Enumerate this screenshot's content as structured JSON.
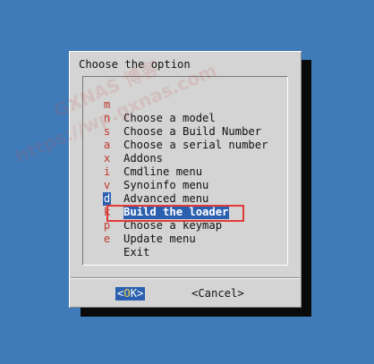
{
  "dialog": {
    "title": "Choose the option"
  },
  "menu": {
    "items": [
      {
        "key": "m",
        "label": "Choose a model"
      },
      {
        "key": "n",
        "label": "Choose a Build Number"
      },
      {
        "key": "s",
        "label": "Choose a serial number"
      },
      {
        "key": "a",
        "label": "Addons"
      },
      {
        "key": "x",
        "label": "Cmdline menu"
      },
      {
        "key": "i",
        "label": "Synoinfo menu"
      },
      {
        "key": "v",
        "label": "Advanced menu"
      },
      {
        "key": "d",
        "label": "Build the loader"
      },
      {
        "key": "k",
        "label": "Choose a keymap"
      },
      {
        "key": "p",
        "label": "Update menu"
      },
      {
        "key": "e",
        "label": "Exit"
      }
    ],
    "selected_index": 7
  },
  "buttons": {
    "ok": {
      "left_bracket": "<",
      "hotkey": "O",
      "rest": "K",
      "right_bracket": ">"
    },
    "cancel_label": "<Cancel>"
  },
  "watermark": {
    "line1": "GXNAS 博客",
    "line2": "https://wp.gxnas.com"
  },
  "colors": {
    "background": "#3e7bb8",
    "dialog": "#d4d4d4",
    "selection": "#2b60b0",
    "hotkey": "#c0392b",
    "annotation": "#e23a3a"
  }
}
